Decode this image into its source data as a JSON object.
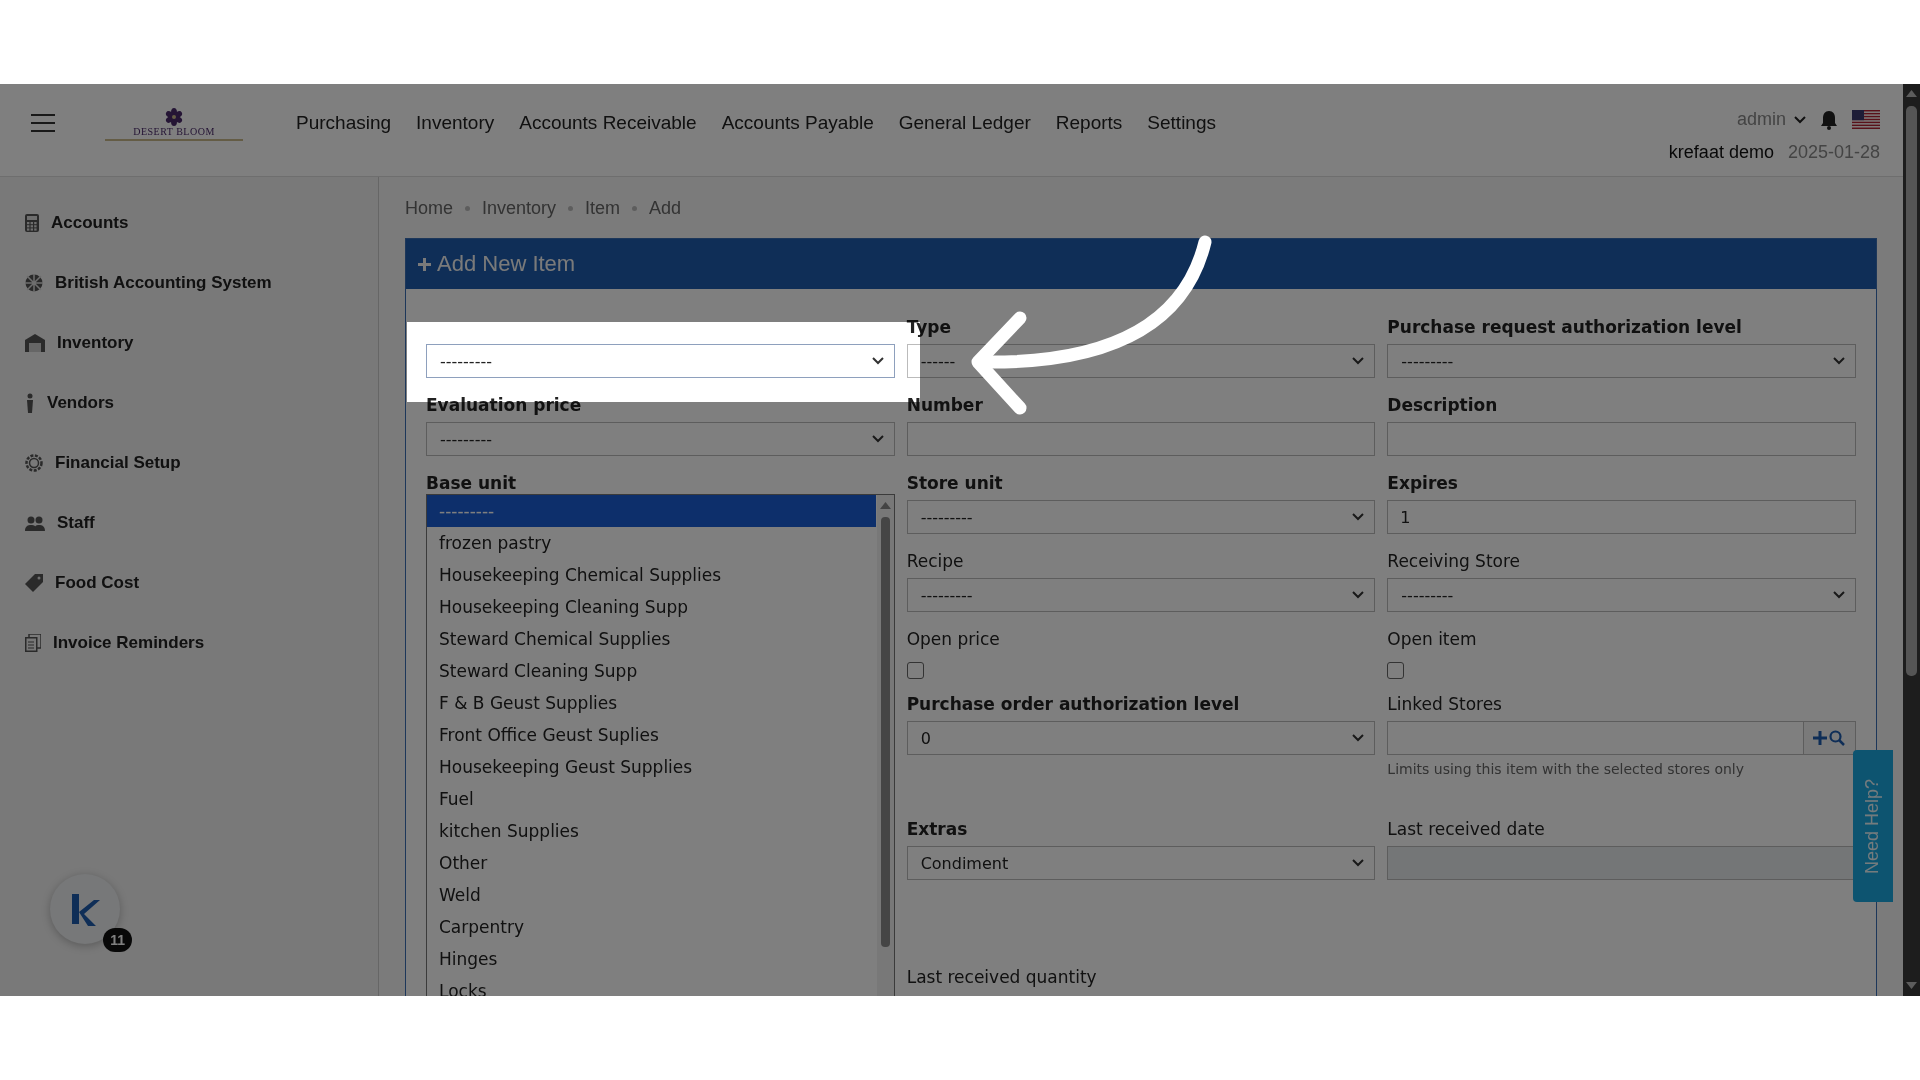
{
  "header": {
    "logo": "DESERT BLOOM",
    "nav": [
      "Purchasing",
      "Inventory",
      "Accounts Receivable",
      "Accounts Payable",
      "General Ledger",
      "Reports",
      "Settings"
    ],
    "user": "admin",
    "account": "krefaat demo",
    "date": "2025-01-28"
  },
  "sidebar": {
    "items": [
      "Accounts",
      "British Accounting System",
      "Inventory",
      "Vendors",
      "Financial Setup",
      "Staff",
      "Food Cost",
      "Invoice Reminders"
    ]
  },
  "breadcrumb": [
    "Home",
    "Inventory",
    "Item",
    "Add"
  ],
  "panel": {
    "title": "Add New Item",
    "columns": [
      [
        {
          "kind": "select",
          "value": "---------"
        },
        {
          "kind": "select",
          "label": "Evaluation price",
          "required": true,
          "value": "---------"
        },
        {
          "kind": "listbox",
          "label": "Base unit",
          "required": true,
          "options": [
            {
              "label": "---------",
              "selected": true
            },
            {
              "label": "frozen pastry",
              "selected": false
            },
            {
              "label": "Housekeeping Chemical Supplies",
              "selected": false
            },
            {
              "label": "Housekeeping Cleaning Supp",
              "selected": false
            },
            {
              "label": "Steward Chemical Supplies",
              "selected": false
            },
            {
              "label": "Steward Cleaning Supp",
              "selected": false
            },
            {
              "label": "F & B Geust Supplies",
              "selected": false
            },
            {
              "label": "Front Office Geust Suplies",
              "selected": false
            },
            {
              "label": "Housekeeping Geust Supplies",
              "selected": false
            },
            {
              "label": "Fuel",
              "selected": false
            },
            {
              "label": "kitchen Supplies",
              "selected": false
            },
            {
              "label": "Other",
              "selected": false
            },
            {
              "label": "Weld",
              "selected": false
            },
            {
              "label": "Carpentry",
              "selected": false
            },
            {
              "label": "Hinges",
              "selected": false
            },
            {
              "label": "Locks",
              "selected": false
            }
          ]
        }
      ],
      [
        {
          "kind": "select",
          "label": "Type",
          "required": true,
          "value": "------"
        },
        {
          "kind": "input",
          "label": "Number",
          "required": true
        },
        {
          "kind": "select",
          "label": "Store unit",
          "required": true,
          "value": "---------"
        },
        {
          "kind": "select",
          "label": "Recipe",
          "required": false,
          "value": "---------"
        },
        {
          "kind": "checkbox",
          "label": "Open price",
          "required": false,
          "checked": false
        },
        {
          "kind": "select",
          "label": "Purchase order authorization level",
          "required": true,
          "value": "0"
        },
        {
          "kind": "select",
          "label": "Extras",
          "required": true,
          "value": "Condiment"
        },
        {
          "kind": "label",
          "label": "Last received quantity",
          "required": false
        }
      ],
      [
        {
          "kind": "select",
          "label": "Purchase request authorization level",
          "required": true,
          "value": "---------"
        },
        {
          "kind": "input",
          "label": "Description",
          "required": true
        },
        {
          "kind": "input",
          "label": "Expires",
          "required": true,
          "value": "1"
        },
        {
          "kind": "select",
          "label": "Receiving Store",
          "required": false,
          "value": "---------"
        },
        {
          "kind": "checkbox",
          "label": "Open item",
          "required": false,
          "checked": false
        },
        {
          "kind": "linked",
          "label": "Linked Stores",
          "required": false,
          "hint": "Limits using this item with the selected stores only"
        },
        {
          "kind": "disabled",
          "label": "Last received date",
          "required": false
        }
      ]
    ]
  },
  "help_tab": "Need Help?",
  "chat_badge": "11"
}
